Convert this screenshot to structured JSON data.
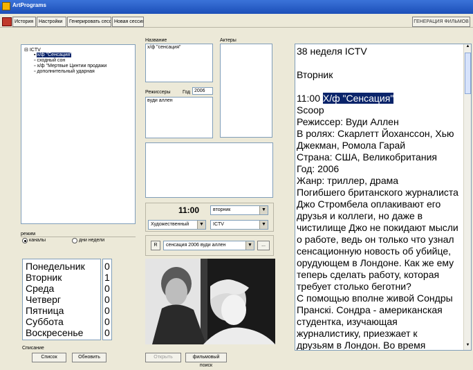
{
  "window": {
    "title": "ArtPrograms"
  },
  "toolbar": {
    "items": [
      "История",
      "Настройки",
      "Генерировать сессии",
      "Новая сессия"
    ],
    "generate_label": "ГЕНЕРАЦИЯ ФИЛЬМОВ"
  },
  "tree": {
    "root": "ICTV",
    "items": [
      {
        "label": "х/ф \"Сенсация\"",
        "selected": true
      },
      {
        "label": "сходный сон",
        "selected": false
      },
      {
        "label": "х/ф \"Мертвые Цинтии продажи",
        "selected": false
      },
      {
        "label": "дополнительный ударная",
        "selected": false
      }
    ]
  },
  "mode": {
    "title": "режим",
    "options": [
      {
        "label": "каналы",
        "checked": true
      },
      {
        "label": "дни недели",
        "checked": false
      }
    ]
  },
  "days": [
    {
      "name": "Понедельник",
      "count": "0"
    },
    {
      "name": "Вторник",
      "count": "1"
    },
    {
      "name": "Среда",
      "count": "0"
    },
    {
      "name": "Четверг",
      "count": "0"
    },
    {
      "name": "Пятница",
      "count": "0"
    },
    {
      "name": "Суббота",
      "count": "0"
    },
    {
      "name": "Воскресенье",
      "count": "0"
    }
  ],
  "list_section": {
    "label": "Списание",
    "list_button": "Список",
    "refresh_button": "Обновить"
  },
  "fields": {
    "title_label": "Название",
    "title_value": "х/ф \"сенсация\"",
    "actors_label": "Актеры",
    "directors_label": "Режиссеры",
    "year_label": "Год",
    "year_value": "2006",
    "directors_value": "вуди аллен"
  },
  "schedule": {
    "time": "11:00",
    "day_select": "вторник",
    "genre_select": "Художественный",
    "channel_select": "ICTV",
    "r_button": "R",
    "film_select": "сенсация 2006 вуди аллен",
    "more_button": "..."
  },
  "bottom_buttons": {
    "open": "Открыть",
    "search": "фильмовый поиск"
  },
  "description": {
    "lines": [
      "38 неделя    ICTV",
      "",
      "Вторник",
      "",
      "11:00 |Х/ф \"Сенсация\"|",
      "Scoop",
      "Режиссер: Вуди Аллен",
      "В ролях: Скарлетт Йоханссон, Хью",
      "Джекман, Ромола Гарай",
      "Страна: США, Великобритания",
      "Год: 2006",
      "Жанр: триллер, драма",
      "Погибшего британского журналиста",
      "Джо Стромбела оплакивают его",
      "друзья и коллеги, но даже в",
      "чистилище Джо не покидают мысли",
      "о работе, ведь он только что узнал",
      "сенсационную новость об убийце,",
      "орудующем в Лондоне. Как же ему",
      "теперь сделать работу, которая",
      "требует столько беготни?",
      "С помощью вполне живой Сондры",
      "Пранскі. Сондра - американская",
      "студентка, изучающая",
      "журналистику, приезжает к",
      "друзьям в Лондон. Во время"
    ]
  }
}
